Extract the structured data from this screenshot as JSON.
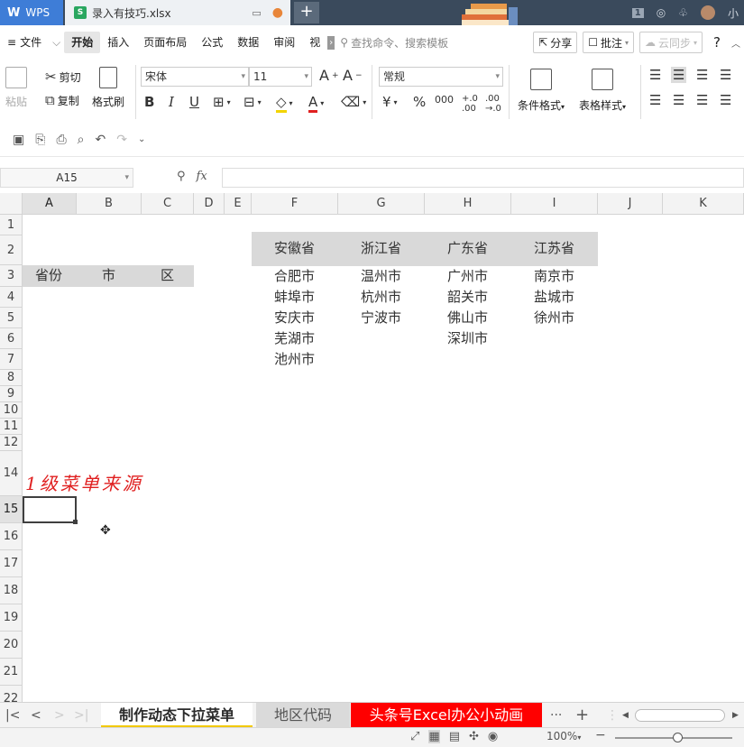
{
  "titlebar": {
    "app_name": "WPS",
    "file_tab": "录入有技巧.xlsx",
    "new_tab_symbol": "+",
    "badge": "1",
    "user_name": "小"
  },
  "menu": {
    "file": "文件",
    "items": [
      "开始",
      "插入",
      "页面布局",
      "公式",
      "数据",
      "审阅",
      "视图"
    ],
    "search_placeholder": "查找命令、搜索模板",
    "share": "分享",
    "comment": "批注",
    "cloud_sync": "云同步",
    "help": "?"
  },
  "toolbar": {
    "paste": "粘贴",
    "cut": "剪切",
    "copy": "复制",
    "format_painter": "格式刷",
    "font_name": "宋体",
    "font_size": "11",
    "number_format": "常规",
    "conditional_format": "条件格式",
    "table_style": "表格样式",
    "bold": "B",
    "italic": "I",
    "underline": "U"
  },
  "formula_bar": {
    "name_box": "A15",
    "fx": "fx",
    "formula": ""
  },
  "grid": {
    "columns": [
      "A",
      "B",
      "C",
      "D",
      "E",
      "F",
      "G",
      "H",
      "I",
      "J",
      "K"
    ],
    "rows": [
      "1",
      "2",
      "3",
      "4",
      "5",
      "6",
      "7",
      "8",
      "9",
      "10",
      "11",
      "12",
      "14",
      "15",
      "16",
      "17",
      "18",
      "19",
      "20",
      "21",
      "22"
    ],
    "row3_headers": {
      "a": "省份",
      "b": "市",
      "c": "区"
    },
    "provinces": [
      {
        "name": "安徽省",
        "cities": [
          "合肥市",
          "蚌埠市",
          "安庆市",
          "芜湖市",
          "池州市"
        ]
      },
      {
        "name": "浙江省",
        "cities": [
          "温州市",
          "杭州市",
          "宁波市"
        ]
      },
      {
        "name": "广东省",
        "cities": [
          "广州市",
          "韶关市",
          "佛山市",
          "深圳市"
        ]
      },
      {
        "name": "江苏省",
        "cities": [
          "南京市",
          "盐城市",
          "徐州市"
        ]
      }
    ],
    "annotation": "1级菜单来源"
  },
  "sheets": {
    "active": "制作动态下拉菜单",
    "second": "地区代码",
    "banner": "头条号Excel办公小动画",
    "more": "···",
    "add": "+"
  },
  "status": {
    "zoom": "100%"
  }
}
